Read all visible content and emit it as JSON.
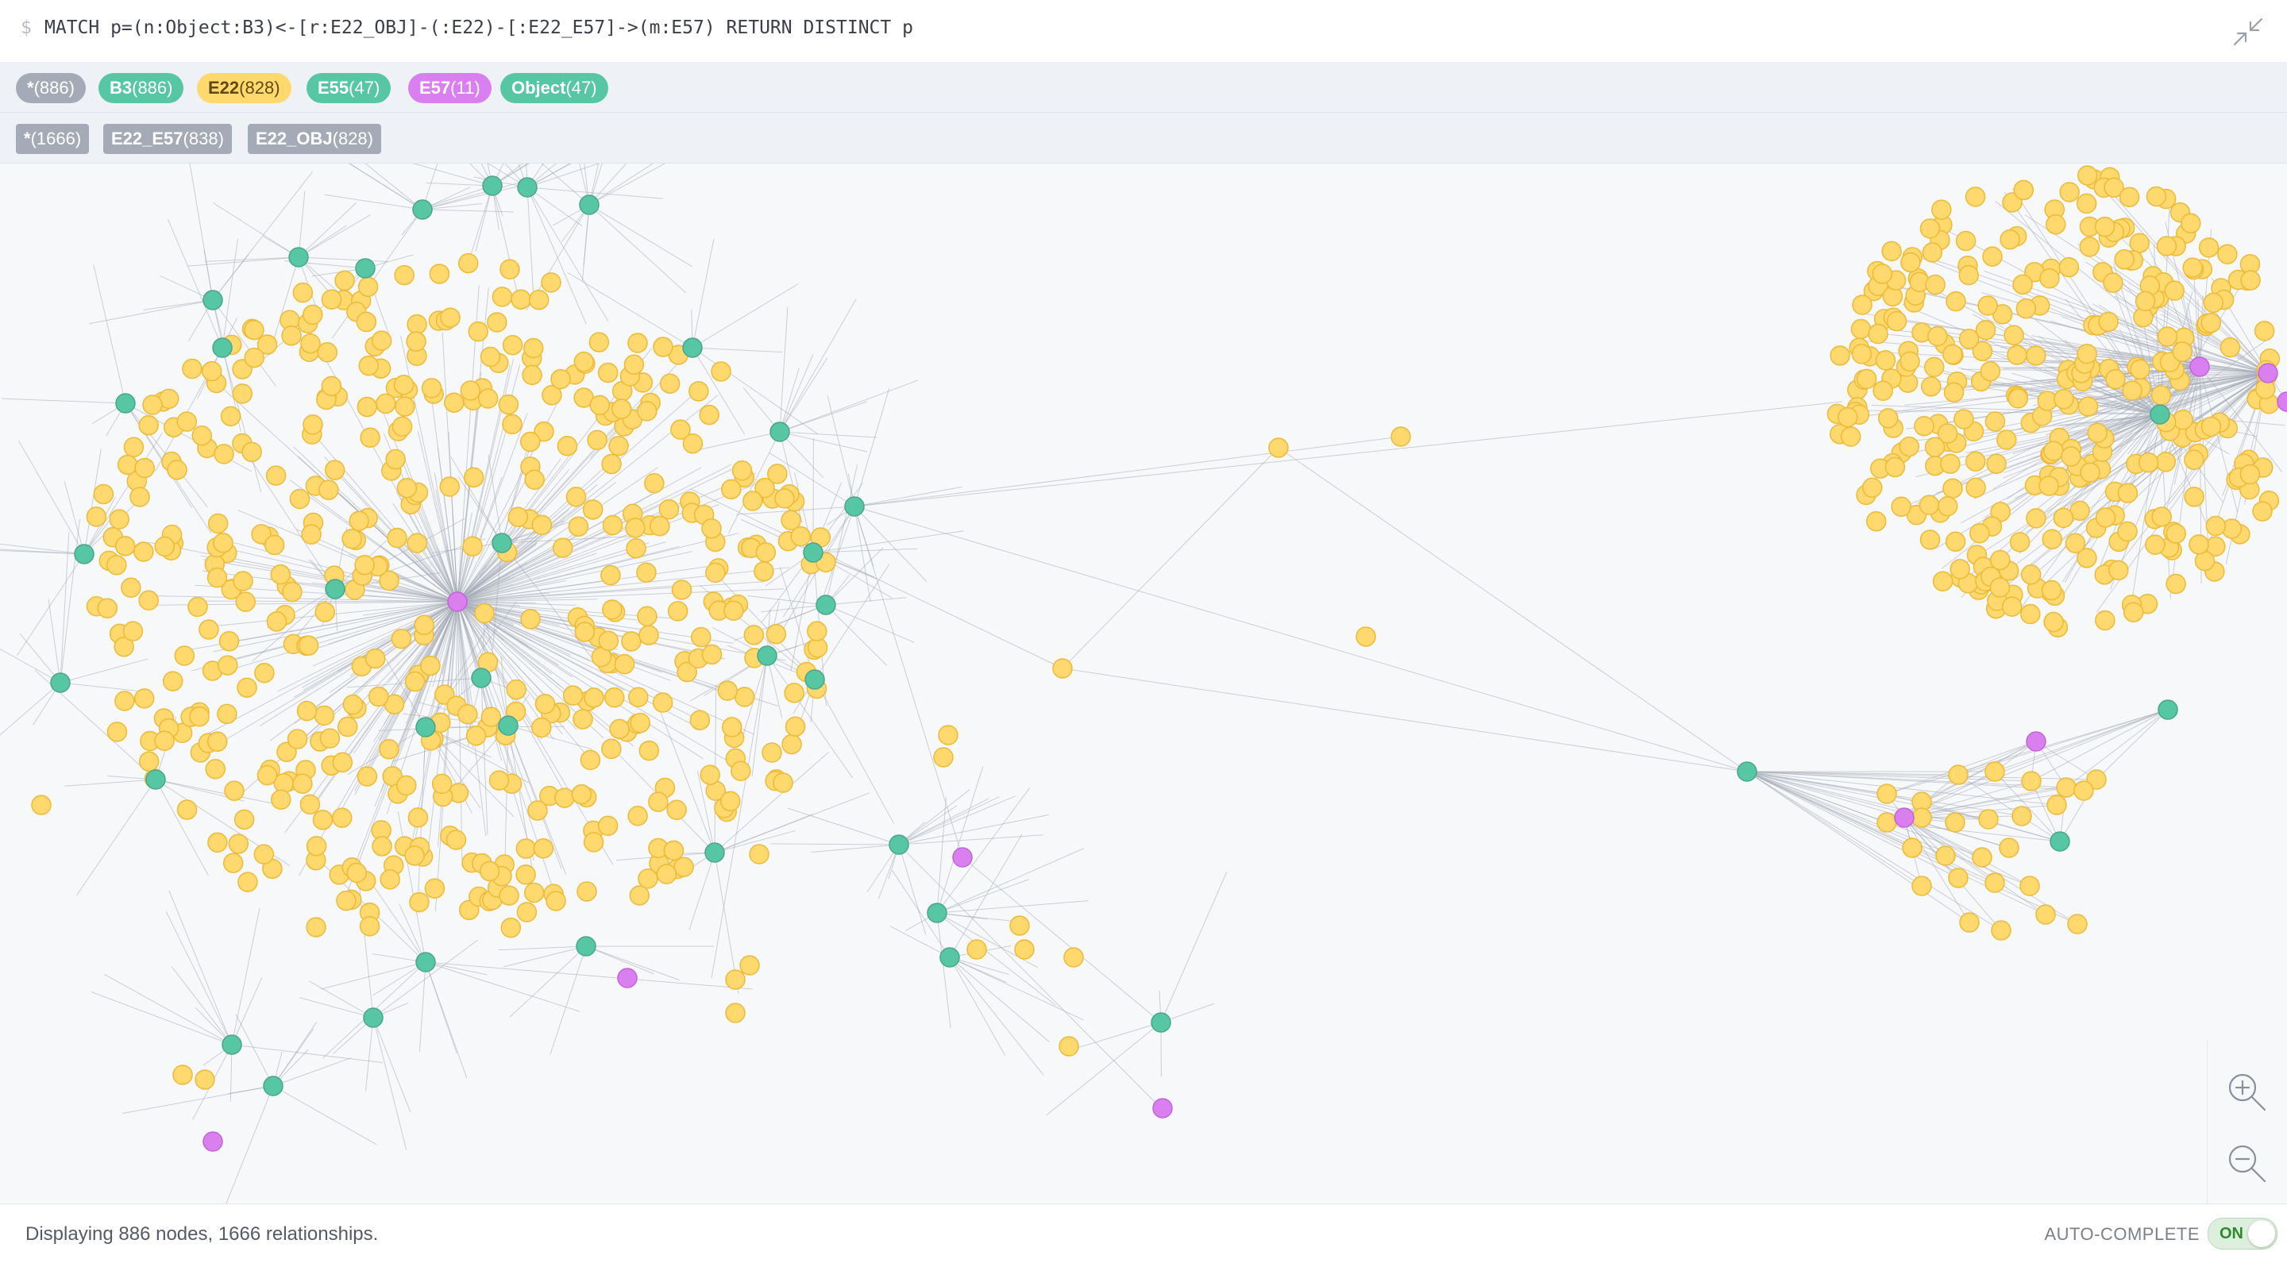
{
  "query": {
    "prompt": "$",
    "text": "MATCH p=(n:Object:B3)<-[r:E22_OBJ]-(:E22)-[:E22_E57]->(m:E57) RETURN DISTINCT p"
  },
  "node_labels": [
    {
      "name": "*",
      "count": "(886)",
      "color": "#a5abb6",
      "text_color": "#ffffff"
    },
    {
      "name": "B3",
      "count": "(886)",
      "color": "#57c7a3",
      "text_color": "#ffffff"
    },
    {
      "name": "E22",
      "count": "(828)",
      "color": "#ffd86e",
      "text_color": "#604a0e"
    },
    {
      "name": "E55",
      "count": "(47)",
      "color": "#57c7a3",
      "text_color": "#ffffff"
    },
    {
      "name": "E57",
      "count": "(11)",
      "color": "#da7ff0",
      "text_color": "#ffffff"
    },
    {
      "name": "Object",
      "count": "(47)",
      "color": "#57c7a3",
      "text_color": "#ffffff"
    }
  ],
  "relationship_types": [
    {
      "name": "*",
      "count": "(1666)"
    },
    {
      "name": "E22_E57",
      "count": "(838)"
    },
    {
      "name": "E22_OBJ",
      "count": "(828)"
    }
  ],
  "graph_colors": {
    "e22": "#ffd86e",
    "e22_stroke": "#edba39",
    "object": "#57c7a3",
    "object_stroke": "#4aa68a",
    "e57": "#da7ff0",
    "e57_stroke": "#c462dc",
    "edge": "#a5abb6"
  },
  "footer": {
    "status": "Displaying 886 nodes, 1666 relationships.",
    "autocomplete_label": "AUTO-COMPLETE",
    "toggle_state": "ON"
  },
  "icons": {
    "collapse": "collapse-arrows-icon",
    "zoom_in": "zoom-in-icon",
    "zoom_out": "zoom-out-icon"
  }
}
